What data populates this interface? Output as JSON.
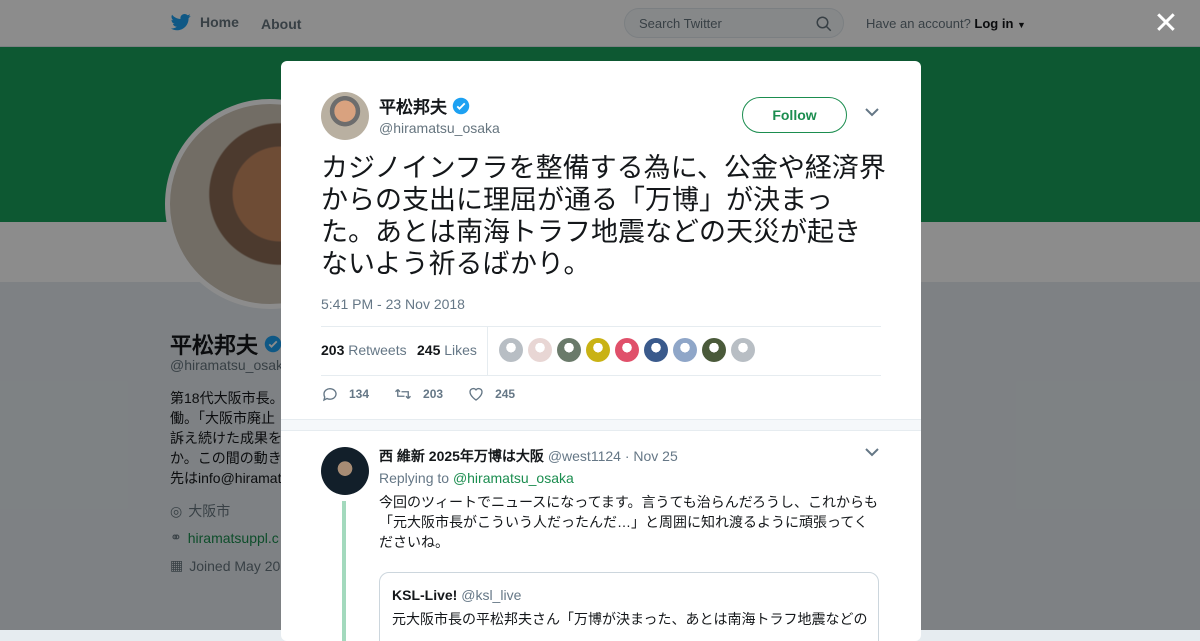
{
  "nav": {
    "home_label": "Home",
    "about_label": "About",
    "search_placeholder": "Search Twitter",
    "account_prompt": "Have an account?",
    "login_label": "Log in"
  },
  "profile": {
    "name": "平松邦夫",
    "handle": "@hiramatsu_osak",
    "bio": "第18代大阪市長。\n働。「大阪市廃止\n訴え続けた成果を\nか。この間の動き\n先はinfo@hiramat",
    "location": "大阪市",
    "website": "hiramatsuppl.c",
    "joined": "Joined May 20"
  },
  "tweet": {
    "author_name": "平松邦夫",
    "author_handle": "@hiramatsu_osaka",
    "follow_label": "Follow",
    "text": "カジノインフラを整備する為に、公金や経済界からの支出に理屈が通る「万博」が決まった。あとは南海トラフ地震などの天災が起きないよう祈るばかり。",
    "timestamp": "5:41 PM - 23 Nov 2018",
    "retweets_count": "203",
    "retweets_label": "Retweets",
    "likes_count": "245",
    "likes_label": "Likes",
    "liker_avatar_colors": [
      "#b8bec4",
      "#e8d6d4",
      "#6a7a6a",
      "#c9b214",
      "#e0506a",
      "#3a5a8c",
      "#8fa6c8",
      "#4a5a3a",
      "#b8bec4"
    ],
    "reply_count": "134",
    "retweet_count": "203",
    "like_count": "245"
  },
  "reply": {
    "author_name": "西 維新 2025年万博は大阪",
    "author_handle": "@west1124",
    "date": "· Nov 25",
    "replying_to_label": "Replying to",
    "replying_to_handle": "@hiramatsu_osaka",
    "text": "今回のツィートでニュースになってます。言うても治らんだろうし、これからも「元大阪市長がこういう人だったんだ…」と周囲に知れ渡るように頑張ってくださいね。",
    "quote": {
      "author_name": "KSL-Live!",
      "author_handle": "@ksl_live",
      "text": "元大阪市長の平松邦夫さん「万博が決まった、あとは南海トラフ地震などの"
    }
  },
  "colors": {
    "brand_green": "#1b8d4f",
    "banner_green": "#19a05c",
    "twitter_blue": "#1da1f2"
  }
}
